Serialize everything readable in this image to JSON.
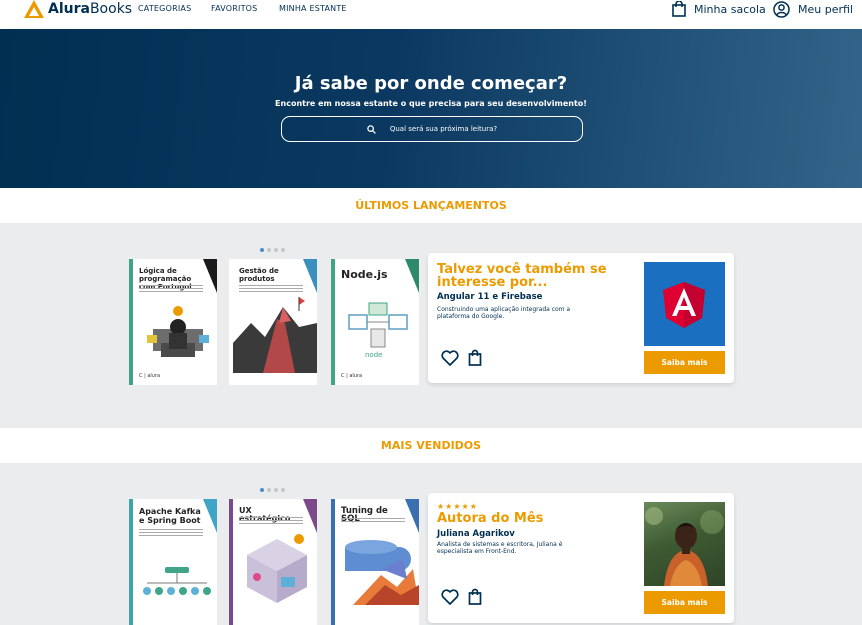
{
  "header": {
    "brand_part1": "Alura",
    "brand_part2": "Books",
    "nav": [
      "CATEGORIAS",
      "FAVORITOS",
      "MINHA ESTANTE"
    ],
    "bag_label": "Minha sacola",
    "profile_label": "Meu perfil"
  },
  "hero": {
    "title": "Já sabe por onde começar?",
    "subtitle": "Encontre em nossa estante o que precisa para seu desenvolvimento!",
    "search_placeholder": "Qual será sua próxima leitura?"
  },
  "sections": {
    "latest": "ÚLTIMOS LANÇAMENTOS",
    "bestsellers": "MAIS VENDIDOS"
  },
  "latest_books": [
    {
      "title": "Lógica de programação com Portugol"
    },
    {
      "title": "Gestão de produtos"
    },
    {
      "title": "Node.js"
    }
  ],
  "bestseller_books": [
    {
      "title": "Apache Kafka e Spring Boot"
    },
    {
      "title": "UX estratégico"
    },
    {
      "title": "Tuning de SQL"
    }
  ],
  "recommend_card": {
    "title": "Talvez você também se interesse por...",
    "book_name": "Angular 11 e Firebase",
    "description": "Construindo uma aplicação integrada com a plataforma do Google.",
    "button": "Saiba mais"
  },
  "author_card": {
    "stars": "★★★★★",
    "title": "Autora do Mês",
    "name": "Juliana Agarikov",
    "description": "Analista de sistemas e escritora, Juliana é especialista em Front-End.",
    "button": "Saiba mais"
  },
  "colors": {
    "primary": "#002f52",
    "accent": "#eb9b00",
    "angular": "#dd0031"
  }
}
